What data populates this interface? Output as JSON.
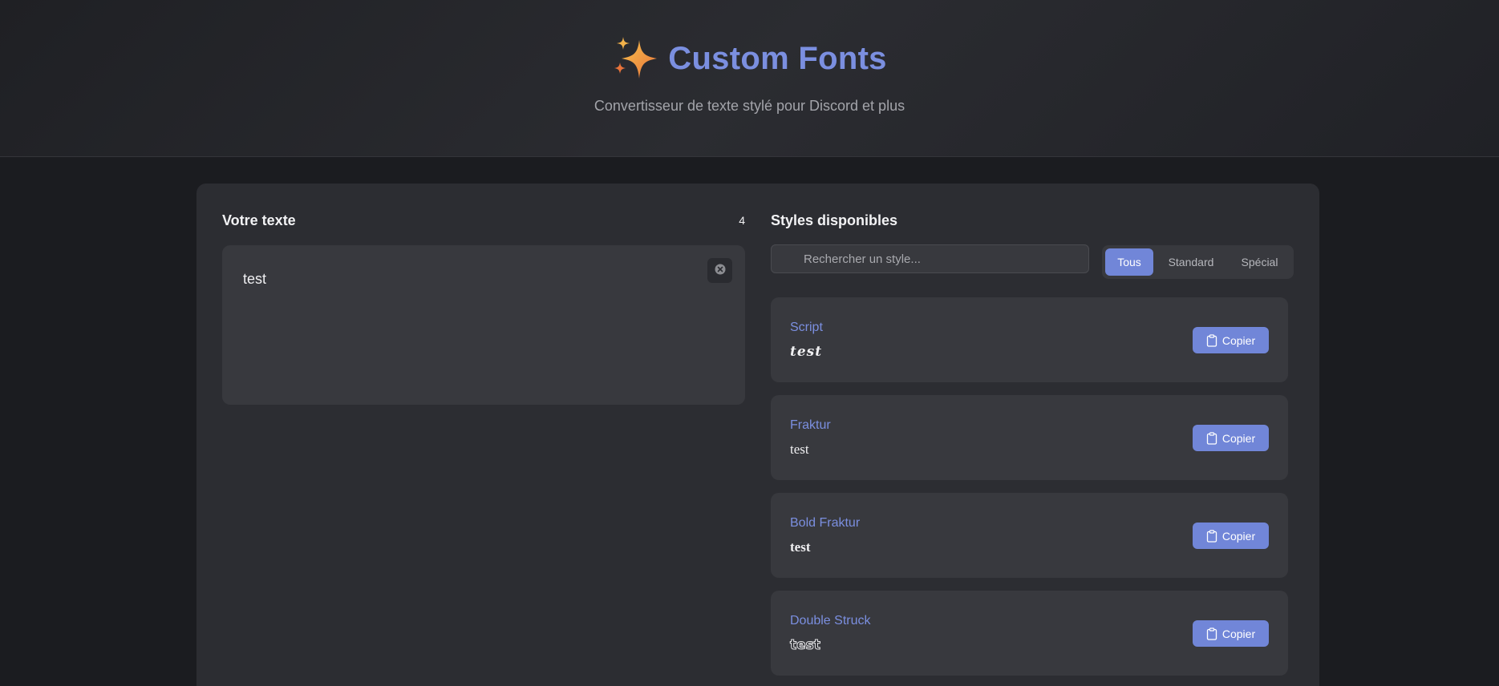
{
  "header": {
    "icon": "sparkle-icon",
    "title": "Custom Fonts",
    "subtitle": "Convertisseur de texte stylé pour Discord et plus"
  },
  "input_panel": {
    "heading": "Votre texte",
    "char_count": "4",
    "text_value": "test",
    "clear_icon": "clear-icon"
  },
  "styles_panel": {
    "heading": "Styles disponibles",
    "search_placeholder": "Rechercher un style...",
    "filters": [
      {
        "label": "Tous",
        "active": true
      },
      {
        "label": "Standard",
        "active": false
      },
      {
        "label": "Spécial",
        "active": false
      }
    ],
    "styles": [
      {
        "name": "Script",
        "preview": "test",
        "copy_label": "Copier"
      },
      {
        "name": "Fraktur",
        "preview": "test",
        "copy_label": "Copier"
      },
      {
        "name": "Bold Fraktur",
        "preview": "test",
        "copy_label": "Copier"
      },
      {
        "name": "Double Struck",
        "preview": "test",
        "copy_label": "Copier"
      }
    ]
  },
  "colors": {
    "accent": "#7186d8",
    "title": "#7b8fe0",
    "background": "#1b1c20",
    "card": "#2c2d32",
    "panel": "#38393e"
  }
}
